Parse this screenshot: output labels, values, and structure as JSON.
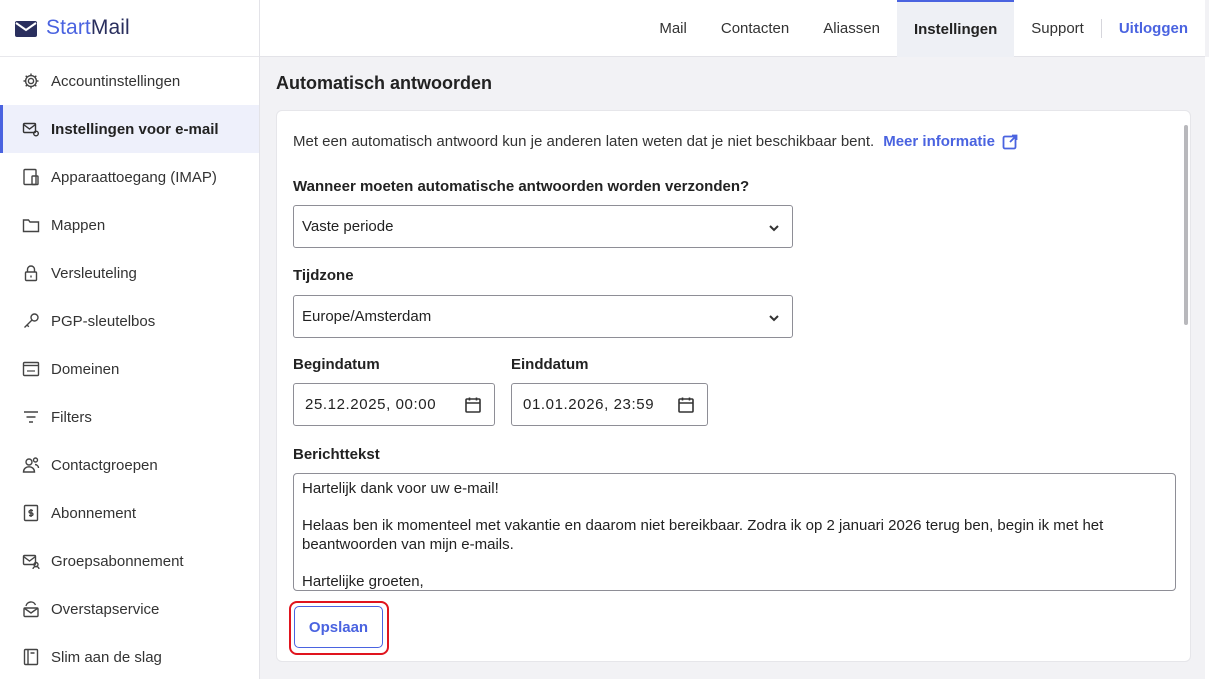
{
  "brand": {
    "start": "Start",
    "mail": "Mail",
    "accent": "#4a63e0"
  },
  "sidebar": {
    "items": [
      {
        "label": "Accountinstellingen",
        "icon": "gear-icon"
      },
      {
        "label": "Instellingen voor e-mail",
        "icon": "mail-settings-icon",
        "active": true
      },
      {
        "label": "Apparaattoegang (IMAP)",
        "icon": "device-icon"
      },
      {
        "label": "Mappen",
        "icon": "folder-icon"
      },
      {
        "label": "Versleuteling",
        "icon": "lock-icon"
      },
      {
        "label": "PGP-sleutelbos",
        "icon": "key-icon"
      },
      {
        "label": "Domeinen",
        "icon": "domain-icon"
      },
      {
        "label": "Filters",
        "icon": "filter-icon"
      },
      {
        "label": "Contactgroepen",
        "icon": "contact-group-icon"
      },
      {
        "label": "Abonnement",
        "icon": "subscription-icon"
      },
      {
        "label": "Groepsabonnement",
        "icon": "group-subscription-icon"
      },
      {
        "label": "Overstapservice",
        "icon": "migration-icon"
      },
      {
        "label": "Slim aan de slag",
        "icon": "book-icon"
      }
    ]
  },
  "topnav": {
    "mail": "Mail",
    "contacts": "Contacten",
    "aliases": "Aliassen",
    "settings": "Instellingen",
    "support": "Support",
    "logout": "Uitloggen"
  },
  "page": {
    "title": "Automatisch antwoorden",
    "intro": "Met een automatisch antwoord kun je anderen laten weten dat je niet beschikbaar bent.",
    "more_info": "Meer informatie",
    "when_label": "Wanneer moeten automatische antwoorden worden verzonden?",
    "when_value": "Vaste periode",
    "timezone_label": "Tijdzone",
    "timezone_value": "Europe/Amsterdam",
    "start_label": "Begindatum",
    "start_value": "25.12.2025, 00:00",
    "end_label": "Einddatum",
    "end_value": "01.01.2026, 23:59",
    "message_label": "Berichttekst",
    "message_lines": [
      "Hartelijk dank voor uw e-mail!",
      "",
      "Helaas ben ik momenteel met vakantie en daarom niet bereikbaar. Zodra ik op 2 januari 2026 terug ben, begin ik met het beantwoorden van mijn e-mails.",
      "",
      "Hartelijke groeten,"
    ],
    "save_label": "Opslaan"
  }
}
